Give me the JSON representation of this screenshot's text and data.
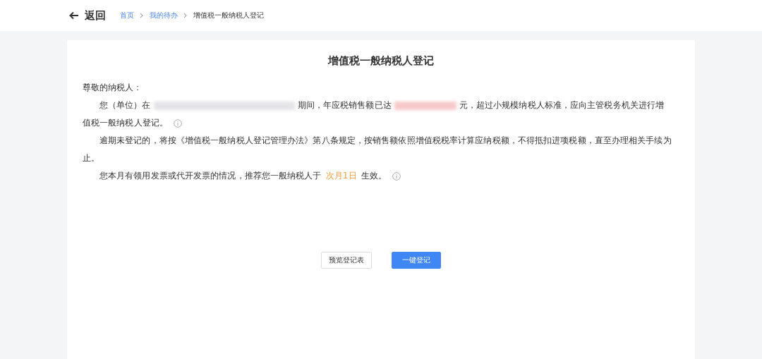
{
  "header": {
    "back_label": "返回",
    "breadcrumb": [
      {
        "label": "首页",
        "link": true
      },
      {
        "label": "我的待办",
        "link": true
      },
      {
        "label": "增值税一般纳税人登记",
        "link": false
      }
    ]
  },
  "card": {
    "title": "增值税一般纳税人登记",
    "greeting": "尊敬的纳税人：",
    "paragraphs": [
      {
        "info": true,
        "parts": [
          {
            "kind": "text",
            "text": "您（单位）在"
          },
          {
            "kind": "redacted"
          },
          {
            "kind": "text",
            "text": "期间，年应税销售额已达"
          },
          {
            "kind": "redacted_amount"
          },
          {
            "kind": "text",
            "text": "元，超过小规模纳税人标准，应向主管税务机关进行增"
          },
          {
            "kind": "text",
            "text": "值税一般纳税人登记。"
          }
        ]
      },
      {
        "info": false,
        "parts": [
          {
            "kind": "text",
            "text": "逾期未登记的，将按《增值税一般纳税人登记管理办法》第八条规定，按销售额依照增值税税率计算应纳税额，不得抵扣进项税额，直至办理相关手续为止。"
          }
        ]
      },
      {
        "info": true,
        "parts": [
          {
            "kind": "text",
            "text": "您本月有领用发票或代开发票的情况，推荐您一般纳税人于"
          },
          {
            "kind": "highlight",
            "text": "次月1日"
          },
          {
            "kind": "text",
            "text": "生效。"
          }
        ]
      }
    ],
    "buttons": [
      {
        "label": "预览登记表",
        "primary": false
      },
      {
        "label": "一键登记",
        "primary": true
      }
    ]
  }
}
